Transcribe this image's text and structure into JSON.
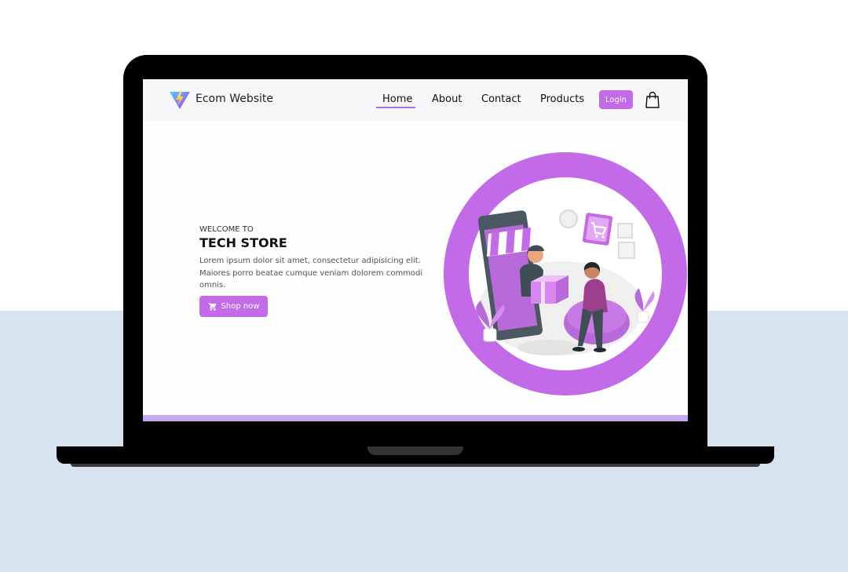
{
  "navbar": {
    "brand": "Ecom Website",
    "links": [
      {
        "label": "Home",
        "active": true
      },
      {
        "label": "About"
      },
      {
        "label": "Contact"
      },
      {
        "label": "Products"
      }
    ],
    "login_label": "Login",
    "cart_icon": "shopping-bag-icon"
  },
  "hero": {
    "welcome": "WELCOME TO",
    "title": "TECH STORE",
    "description": "Lorem ipsum dolor sit amet, consectetur adipisicing elit. Maiores porro beatae cumque veniam dolorem commodi omnis.",
    "shop_label": "Shop now",
    "shop_icon": "cart-icon"
  },
  "colors": {
    "accent": "#c36ae9",
    "page_bottom": "#d6e3ef",
    "footer_strip": "#c7a9f2"
  }
}
